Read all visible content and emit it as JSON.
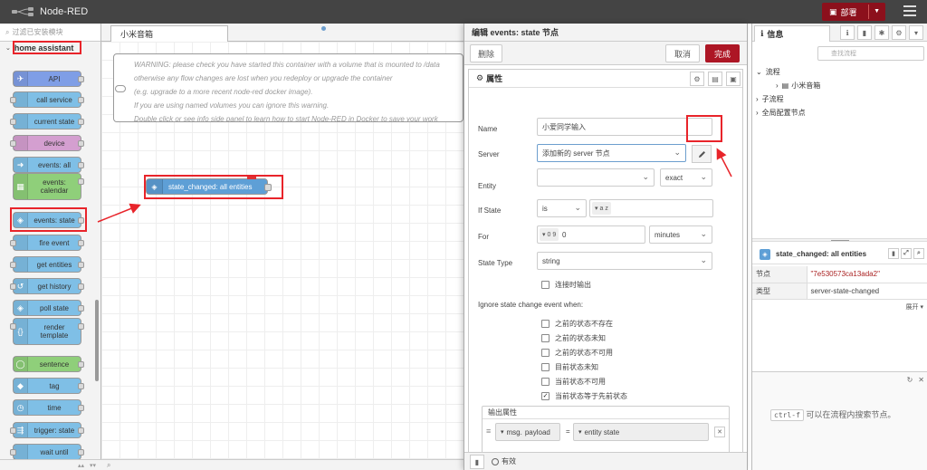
{
  "header": {
    "app_title": "Node-RED",
    "deploy_label": "部署"
  },
  "palette": {
    "search_placeholder": "过滤已安装模块",
    "category": "home assistant",
    "nodes": [
      {
        "label": "API",
        "color": "#7f9ee6",
        "icon": "✈",
        "side": "left"
      },
      {
        "label": "call service",
        "color": "#7fbfe6",
        "icon": "",
        "side": "both"
      },
      {
        "label": "current state",
        "color": "#7fbfe6",
        "icon": "",
        "side": "both"
      },
      {
        "label": "device",
        "color": "#d49fd0",
        "icon": "",
        "side": "both"
      },
      {
        "label": "events: all",
        "color": "#7fbfe6",
        "icon": "➜",
        "side": "left"
      },
      {
        "label": "events: calendar",
        "color": "#8fcf7a",
        "icon": "▦",
        "side": "left"
      },
      {
        "label": "events: state",
        "color": "#7fbfe6",
        "icon": "◈",
        "side": "left"
      },
      {
        "label": "fire event",
        "color": "#7fbfe6",
        "icon": "",
        "side": "both"
      },
      {
        "label": "get entities",
        "color": "#7fbfe6",
        "icon": "",
        "side": "both"
      },
      {
        "label": "get history",
        "color": "#7fbfe6",
        "icon": "↺",
        "side": "both"
      },
      {
        "label": "poll state",
        "color": "#7fbfe6",
        "icon": "◈",
        "side": "left"
      },
      {
        "label": "render template",
        "color": "#7fbfe6",
        "icon": "{}",
        "side": "both"
      },
      {
        "label": "sentence",
        "color": "#8fcf7a",
        "icon": "◯",
        "side": "left"
      },
      {
        "label": "tag",
        "color": "#7fbfe6",
        "icon": "◆",
        "side": "left"
      },
      {
        "label": "time",
        "color": "#7fbfe6",
        "icon": "◷",
        "side": "left"
      },
      {
        "label": "trigger: state",
        "color": "#7fbfe6",
        "icon": "⇶",
        "side": "both"
      },
      {
        "label": "wait until",
        "color": "#7fbfe6",
        "icon": "",
        "side": "both"
      }
    ]
  },
  "workspace": {
    "tab_label": "小米音箱",
    "comment_lines": [
      "WARNING: please check you have started this container with a volume that is mounted to /data",
      "otherwise any flow changes are lost when you redeploy or upgrade the container",
      "(e.g. upgrade to a more recent node-red docker image).",
      "If you are using named volumes you can ignore this warning.",
      "Double click or see info side panel to learn how to start Node-RED in Docker to save your work"
    ],
    "node_label": "state_changed: all entities"
  },
  "tray": {
    "title": "编辑 events: state 节点",
    "delete_label": "删除",
    "cancel_label": "取消",
    "done_label": "完成",
    "section_label": "属性",
    "name_label": "Name",
    "name_value": "小爱同学输入",
    "server_label": "Server",
    "server_value": "添加新的 server 节点",
    "entity_label": "Entity",
    "entity_value": "",
    "entity_match": "exact",
    "if_state_label": "If State",
    "if_state_op": "is",
    "if_state_type": "a z",
    "if_state_value": "",
    "for_label": "For",
    "for_type": "0 9",
    "for_value": "0",
    "for_unit": "minutes",
    "state_type_label": "State Type",
    "state_type_value": "string",
    "output_on_connect": "连接时输出",
    "ignore_label": "Ignore state change event when:",
    "ignore_options": [
      {
        "label": "之前的状态不存在",
        "checked": false
      },
      {
        "label": "之前的状态未知",
        "checked": false
      },
      {
        "label": "之前的状态不可用",
        "checked": false
      },
      {
        "label": "目前状态未知",
        "checked": false
      },
      {
        "label": "当前状态不可用",
        "checked": false
      },
      {
        "label": "当前状态等于先前状态",
        "checked": true
      }
    ],
    "output_props_label": "输出属性",
    "output_row": {
      "prefix": "msg.",
      "field": "payload",
      "eq": "=",
      "value": "entity state"
    },
    "footer_enabled": "有效"
  },
  "sidebar": {
    "tab_label": "信息",
    "search_placeholder": "查找流程",
    "tree": [
      {
        "label": "流程",
        "level": 0,
        "arrow": "⌄"
      },
      {
        "label": "小米音箱",
        "level": 1,
        "arrow": "›"
      },
      {
        "label": "子流程",
        "level": 0,
        "arrow": "›"
      },
      {
        "label": "全局配置节点",
        "level": 0,
        "arrow": "›"
      }
    ],
    "node_title": "state_changed: all entities",
    "node_props": [
      {
        "key": "节点",
        "value": "\"7e530573ca13ada2\""
      },
      {
        "key": "类型",
        "value": "server-state-changed"
      }
    ],
    "expand_label": "展开",
    "help_key": "ctrl-f",
    "help_text": "可以在流程内搜索节点。"
  },
  "colors": {
    "header_bg": "#444444",
    "deploy_bg": "#8c101c",
    "done_bg": "#ad1625",
    "node_blue": "#5e9fd6",
    "annotation_red": "#e8242a",
    "node_id_red": "#aa2222"
  }
}
